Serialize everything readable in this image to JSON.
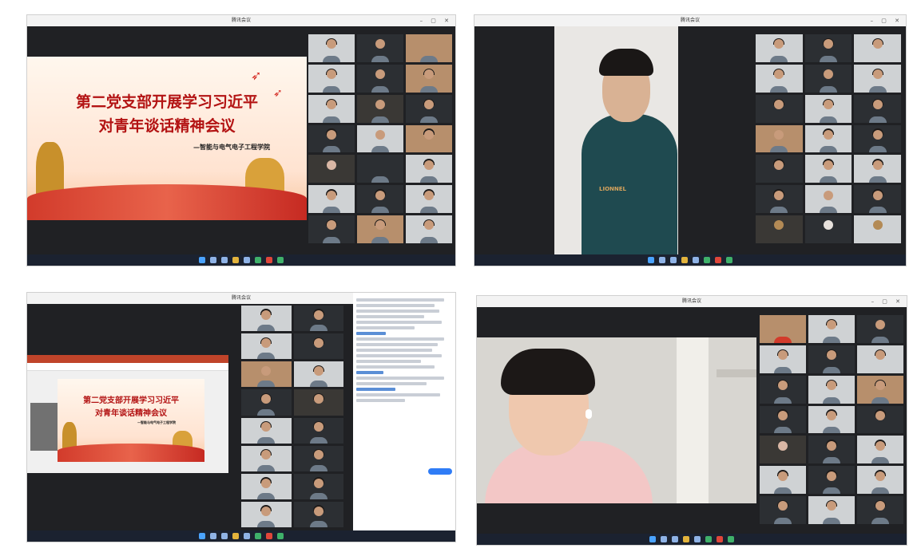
{
  "window_title": "腾讯会议",
  "slide": {
    "title_line1": "第二党支部开展学习习近平",
    "title_line2": "对青年谈话精神会议",
    "subtitle": "—智能与电气电子工程学院"
  },
  "shirt_text": "LIONNEL",
  "icons": {
    "taskbar": [
      "windows-start-icon",
      "search-icon",
      "task-view-icon",
      "file-explorer-icon",
      "edge-icon",
      "store-icon",
      "xbox-icon",
      "wechat-icon"
    ]
  },
  "colors": {
    "taskbar": "#1b2230",
    "slide_title": "#b31313",
    "meeting_bg": "#202124"
  }
}
